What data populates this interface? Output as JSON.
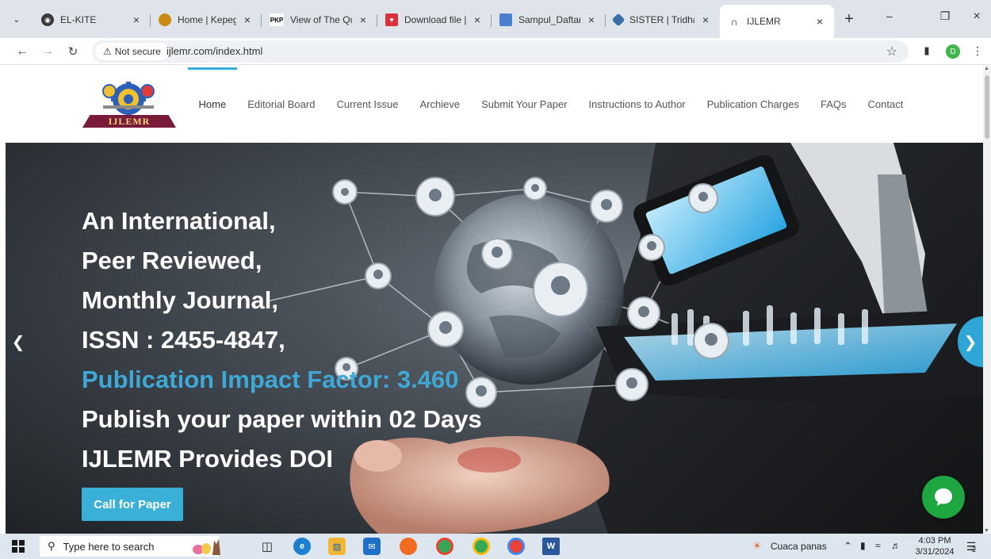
{
  "browser": {
    "tabs": [
      {
        "title": "EL-KITE",
        "favicon_color": "#3a3a3a",
        "active": false
      },
      {
        "title": "Home | Kepegav",
        "favicon_color": "#c98b12",
        "active": false
      },
      {
        "title": "View of The Qua",
        "favicon_text": "PKP",
        "active": false
      },
      {
        "title": "Download file | ",
        "favicon_color": "#d9323a",
        "active": false
      },
      {
        "title": "Sampul_Daftar I",
        "favicon_color": "#4b7fd0",
        "active": false
      },
      {
        "title": "SISTER | Tridharm",
        "favicon_color": "#3a6ea8",
        "active": false
      },
      {
        "title": "IJLEMR",
        "favicon_color": "#333333",
        "active": true
      }
    ],
    "security_label": "Not secure",
    "url": "ijlemr.com/index.html",
    "profile_initial": "D"
  },
  "site": {
    "logo_text": "IJLEMR",
    "menu": [
      {
        "label": "Home",
        "active": true
      },
      {
        "label": "Editorial Board"
      },
      {
        "label": "Current Issue"
      },
      {
        "label": "Archieve"
      },
      {
        "label": "Submit Your Paper"
      },
      {
        "label": "Instructions to Author"
      },
      {
        "label": "Publication Charges"
      },
      {
        "label": "FAQs"
      },
      {
        "label": "Contact"
      }
    ]
  },
  "hero": {
    "lines": [
      "An International,",
      "Peer Reviewed,",
      "Monthly Journal,",
      "ISSN : 2455-4847,",
      "Publication Impact Factor: 3.460",
      "Publish your paper within 02 Days",
      "IJLEMR Provides DOI"
    ],
    "highlight_index": 4,
    "cta_label": "Call for Paper",
    "accent_color": "#3ab0d8"
  },
  "taskbar": {
    "search_placeholder": "Type here to search",
    "weather_text": "Cuaca panas",
    "time": "4:03 PM",
    "date": "3/31/2024",
    "notification_count": "2"
  }
}
